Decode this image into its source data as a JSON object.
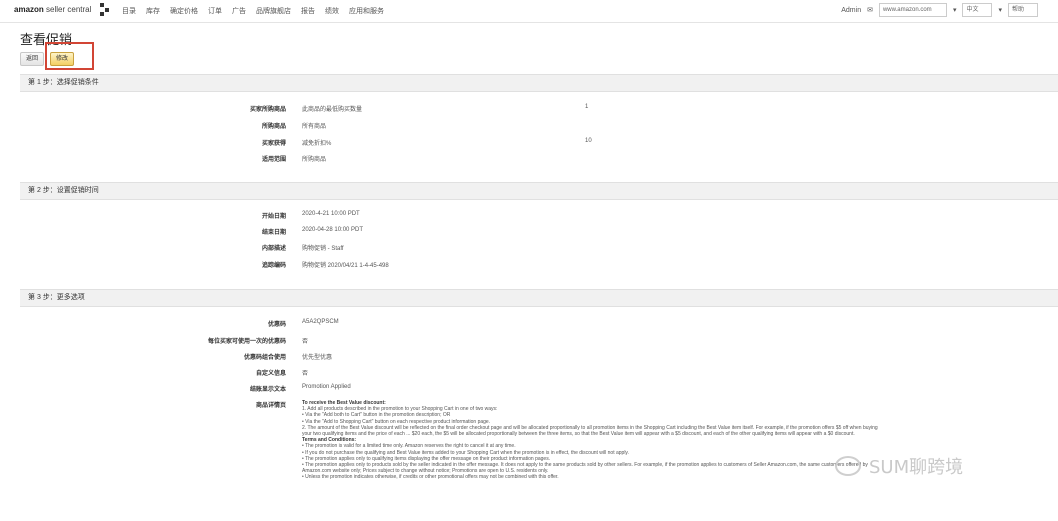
{
  "header": {
    "logo_brand": "amazon",
    "logo_suffix": "seller central",
    "nav": [
      "目录",
      "库存",
      "确定价格",
      "订单",
      "广告",
      "品牌旗舰店",
      "报告",
      "绩效",
      "应用和服务"
    ],
    "right_label": "Admin",
    "site_select": "www.amazon.com",
    "lang_select": "中文",
    "help_select": "帮助"
  },
  "page": {
    "title": "查看促销",
    "btn_back": "返回",
    "btn_edit": "修改"
  },
  "step1": {
    "heading": "第 1 步：选择促销条件",
    "rows": [
      {
        "label": "买家所购商品",
        "value": "此商品的最低购买数量",
        "extra": "1"
      },
      {
        "label": "所购商品",
        "value": "所有商品"
      },
      {
        "label": "买家获得",
        "value": "减免折扣%",
        "extra": "10"
      },
      {
        "label": "适用范围",
        "value": "所购商品"
      }
    ]
  },
  "step2": {
    "heading": "第 2 步：设置促销时间",
    "rows": [
      {
        "label": "开始日期",
        "value": "2020-4-21  10:00  PDT"
      },
      {
        "label": "结束日期",
        "value": "2020-04-28  10:00  PDT"
      },
      {
        "label": "内部描述",
        "value": "购物促销 - Staff"
      },
      {
        "label": "追踪编码",
        "value": "购物促销 2020/04/21 1-4-45-498"
      }
    ]
  },
  "step3": {
    "heading": "第 3 步：更多选项",
    "rows": [
      {
        "label": "优惠码",
        "value": "A5A2QPSCM"
      },
      {
        "label": "每位买家可使用一次的优惠码",
        "value": "否"
      },
      {
        "label": "优惠码组合使用",
        "value": "优先型优惠"
      },
      {
        "label": "自定义信息",
        "value": "否"
      },
      {
        "label": "结账显示文本",
        "value": "Promotion Applied"
      }
    ],
    "detail_label": "商品详情页",
    "detail_lines": [
      "To receive the Best Value discount:",
      "1. Add all products described in the promotion to your Shopping Cart in one of two ways:",
      "  • Via the \"Add both to Cart\" button in the promotion description; OR",
      "  • Via the \"Add to Shopping Cart\" button on each respective product information page.",
      "2. The amount of the Best Value discount will be reflected on the final order checkout page and will be allocated proportionally to all promotion items in the Shopping Cart including the Best Value item itself. For example, if the promotion offers $5 off when buying",
      "your two qualifying items and the price of each ... $20 each, the $5 will be allocated proportionally between the three items, so that the Best Value item will appear with a $5 discount, and each of the other qualifying items will appear with a $0 discount.",
      "Terms and Conditions:",
      "• The promotion is valid for a limited time only. Amazon reserves the right to cancel it at any time.",
      "• If you do not purchase the qualifying and Best Value items added to your Shopping Cart when the promotion is in effect, the discount will not apply.",
      "• The promotion applies only to qualifying items displaying the offer message on their product information pages.",
      "• The promotion applies only to products sold by the seller indicated in the offer message. It does not apply to the same products sold by other sellers. For example, if the promotion applies to customers of Seller Amazon.com, the same customers offered by",
      "  Amazon.com website only; Prices subject to change without notice; Promotions are open to U.S. residents only.",
      "• Unless the promotion indicates otherwise, if credits or other promotional offers may not be combined with this offer."
    ]
  },
  "watermark": "SUM聊跨境",
  "colors": {
    "highlight": "#d24535",
    "active_button": "#f3cf64"
  }
}
